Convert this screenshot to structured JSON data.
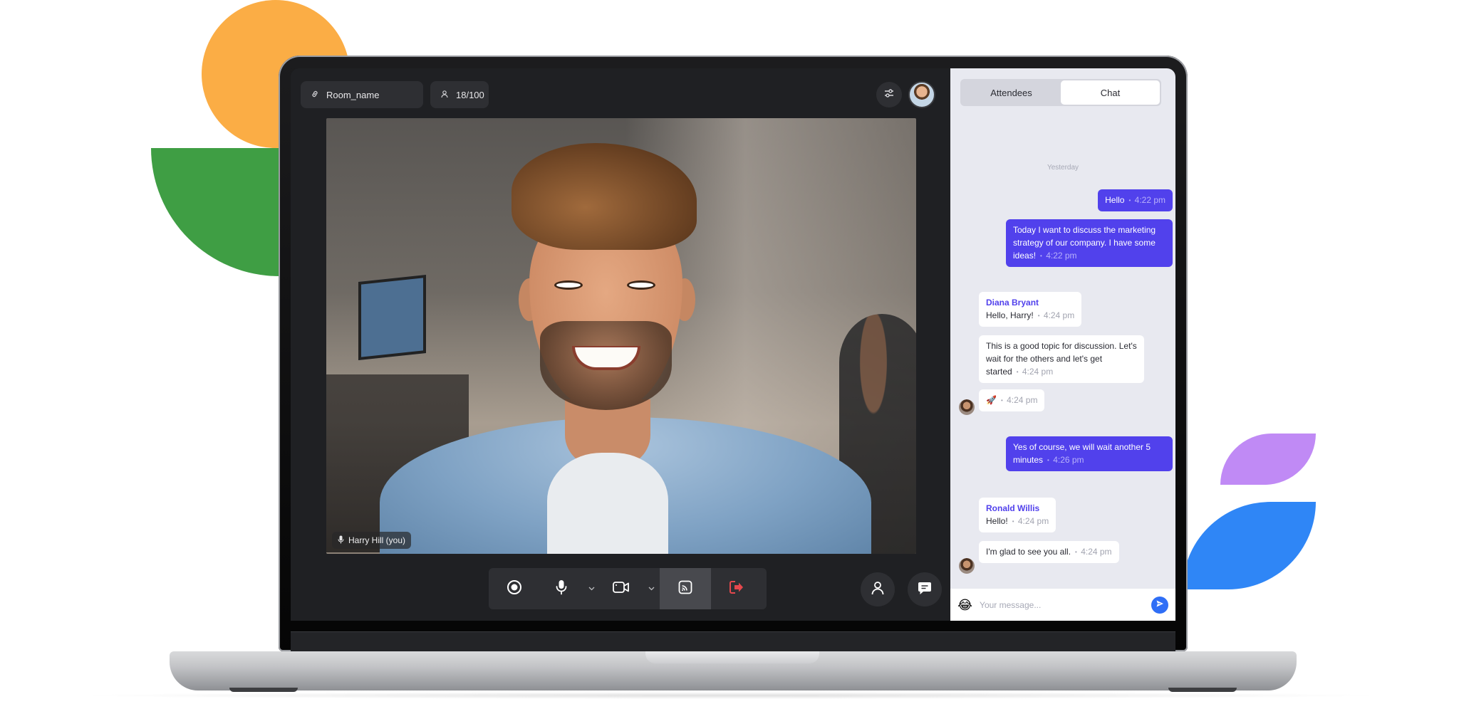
{
  "room": {
    "name": "Room_name",
    "participants": "18/100"
  },
  "video": {
    "participant_label": "Harry Hill (you)"
  },
  "chat": {
    "tabs": [
      {
        "label": "Attendees",
        "active": false
      },
      {
        "label": "Chat",
        "active": true
      }
    ],
    "day_separator": "Yesterday",
    "messages": [
      {
        "text": "Hello",
        "time": "4:22 pm",
        "from_me": true
      },
      {
        "text": "Today I want to discuss the marketing strategy of our company. I have some ideas!",
        "time": "4:22 pm",
        "from_me": true
      },
      {
        "sender": "Diana Bryant",
        "text": "Hello, Harry!",
        "time": "4:24 pm",
        "from_me": false
      },
      {
        "text": "This is a good topic for discussion. Let's wait for the others and let's get started",
        "time": "4:24 pm",
        "from_me": false
      },
      {
        "text": "🚀",
        "time": "4:24 pm",
        "from_me": false
      },
      {
        "text": "Yes of course, we will wait another 5 minutes",
        "time": "4:26 pm",
        "from_me": true
      },
      {
        "sender": "Ronald Willis",
        "text": "Hello!",
        "time": "4:24 pm",
        "from_me": false
      },
      {
        "text": "I'm glad to see you all.",
        "time": "4:24 pm",
        "from_me": false
      }
    ],
    "composer": {
      "placeholder": "Your message...",
      "emoji": "😂"
    }
  },
  "icons": [
    "link-icon",
    "user-icon",
    "settings-sliders-icon",
    "record-icon",
    "microphone-icon",
    "chevron-down-icon",
    "camera-icon",
    "cast-icon",
    "leave-icon",
    "people-icon",
    "chat-icon",
    "send-icon"
  ],
  "colors": {
    "accent": "#5141ec",
    "leave": "#e5484d",
    "send": "#2f6ef6",
    "panel": "#e8e9f0"
  }
}
